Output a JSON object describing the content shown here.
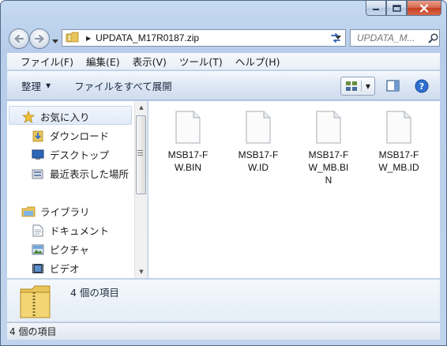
{
  "window": {
    "caption_buttons": [
      "minimize",
      "maximize",
      "close"
    ]
  },
  "address_bar": {
    "path": "UPDATA_M17R0187.zip"
  },
  "search": {
    "placeholder": "UPDATA_M..."
  },
  "menu": {
    "items": [
      "ファイル(F)",
      "編集(E)",
      "表示(V)",
      "ツール(T)",
      "ヘルプ(H)"
    ]
  },
  "toolbar": {
    "organize_label": "整理",
    "extract_label": "ファイルをすべて展開"
  },
  "sidebar": {
    "favorites_label": "お気に入り",
    "favorites": [
      "ダウンロード",
      "デスクトップ",
      "最近表示した場所"
    ],
    "libraries_label": "ライブラリ",
    "libraries": [
      "ドキュメント",
      "ピクチャ",
      "ビデオ"
    ]
  },
  "files": [
    {
      "name": "MSB17-FW.BIN",
      "lines": [
        "MSB17-F",
        "W.BIN"
      ]
    },
    {
      "name": "MSB17-FW.ID",
      "lines": [
        "MSB17-F",
        "W.ID"
      ]
    },
    {
      "name": "MSB17-FW_MB.BIN",
      "lines": [
        "MSB17-F",
        "W_MB.BI",
        "N"
      ]
    },
    {
      "name": "MSB17-FW_MB.ID",
      "lines": [
        "MSB17-F",
        "W_MB.ID"
      ]
    }
  ],
  "details": {
    "count_text": "4 個の項目"
  },
  "status": {
    "text": "4 個の項目"
  },
  "colors": {
    "frame": "#b7cde9",
    "toolbar": "#dce7f5",
    "favorites_highlight": "#e0eaf7"
  },
  "icons": [
    "folder-icon",
    "star-icon",
    "download-folder-icon",
    "desktop-icon",
    "recent-places-icon",
    "library-icon",
    "documents-icon",
    "pictures-icon",
    "videos-icon",
    "file-icon",
    "zip-folder-icon",
    "search-icon",
    "refresh-icon",
    "help-icon",
    "preview-pane-icon",
    "view-icon"
  ]
}
